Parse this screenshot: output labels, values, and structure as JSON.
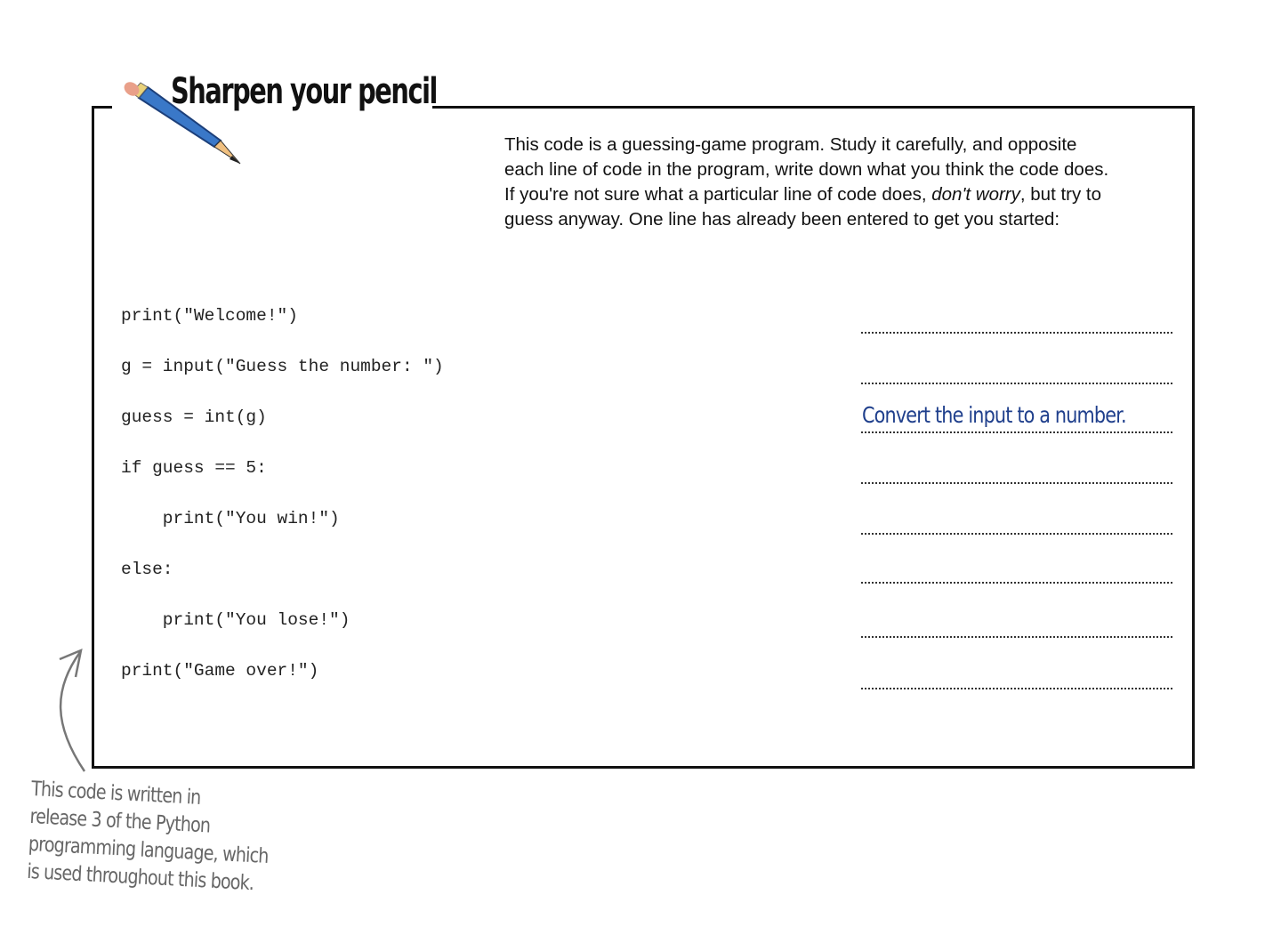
{
  "header": {
    "title": "Sharpen your pencil"
  },
  "intro": {
    "text_before": "This code is a guessing-game program. Study it carefully, and opposite each line of code in the program, write down what you think the code does. If you're not sure what a particular line of code does, ",
    "text_emphasis": "don't worry",
    "text_after": ", but try to guess anyway. One line has already been entered to get you started:"
  },
  "code_lines": [
    "print(\"Welcome!\")",
    "g = input(\"Guess the number: \")",
    "guess = int(g)",
    "if guess == 5:",
    "    print(\"You win!\")",
    "else:",
    "    print(\"You lose!\")",
    "print(\"Game over!\")"
  ],
  "answers": {
    "line3": "Convert the input to a number."
  },
  "annotation": {
    "lines": [
      "This code is written in",
      "release 3 of the Python",
      "programming language, which",
      "is used throughout this book."
    ]
  },
  "colors": {
    "answer": "#1f3f8c",
    "annotation": "#666666"
  }
}
